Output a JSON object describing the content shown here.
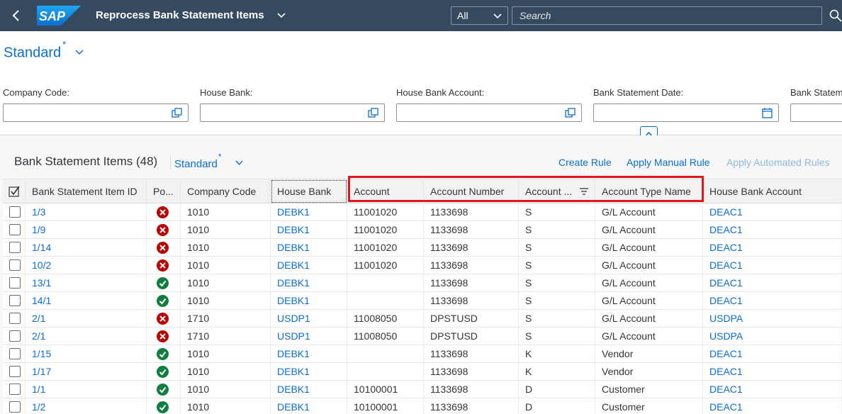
{
  "shell": {
    "app_title": "Reprocess Bank Statement Items",
    "logo_text": "SAP",
    "search_scope": "All",
    "search_placeholder": "Search"
  },
  "variant": {
    "name": "Standard",
    "modified_marker": "*"
  },
  "filters": [
    {
      "label": "Company Code:",
      "value": ""
    },
    {
      "label": "House Bank:",
      "value": ""
    },
    {
      "label": "House Bank Account:",
      "value": ""
    },
    {
      "label": "Bank Statement Date:",
      "value": ""
    },
    {
      "label": "Bank Statem",
      "value": ""
    }
  ],
  "table": {
    "title": "Bank Statement Items (48)",
    "variant_name": "Standard",
    "variant_marker": "*",
    "actions": {
      "create_rule": "Create Rule",
      "apply_manual_rule": "Apply Manual Rule",
      "apply_automated_rules": "Apply Automated Rules"
    },
    "columns": [
      "Bank Statement Item ID",
      "Po...",
      "Company Code",
      "House Bank",
      "Account",
      "Account Number",
      "Account ...",
      "Account Type Name",
      "House Bank Account"
    ],
    "rows": [
      {
        "id": "1/3",
        "status": "error",
        "company": "1010",
        "bank": "DEBK1",
        "account": "11001020",
        "number": "1133698",
        "type": "S",
        "type_name": "G/L Account",
        "hba": "DEAC1"
      },
      {
        "id": "1/9",
        "status": "error",
        "company": "1010",
        "bank": "DEBK1",
        "account": "11001020",
        "number": "1133698",
        "type": "S",
        "type_name": "G/L Account",
        "hba": "DEAC1"
      },
      {
        "id": "1/14",
        "status": "error",
        "company": "1010",
        "bank": "DEBK1",
        "account": "11001020",
        "number": "1133698",
        "type": "S",
        "type_name": "G/L Account",
        "hba": "DEAC1"
      },
      {
        "id": "10/2",
        "status": "error",
        "company": "1010",
        "bank": "DEBK1",
        "account": "11001020",
        "number": "1133698",
        "type": "S",
        "type_name": "G/L Account",
        "hba": "DEAC1"
      },
      {
        "id": "13/1",
        "status": "success",
        "company": "1010",
        "bank": "DEBK1",
        "account": "",
        "number": "1133698",
        "type": "S",
        "type_name": "G/L Account",
        "hba": "DEAC1"
      },
      {
        "id": "14/1",
        "status": "success",
        "company": "1010",
        "bank": "DEBK1",
        "account": "",
        "number": "1133698",
        "type": "S",
        "type_name": "G/L Account",
        "hba": "DEAC1"
      },
      {
        "id": "2/1",
        "status": "error",
        "company": "1710",
        "bank": "USDP1",
        "account": "11008050",
        "number": "DPSTUSD",
        "type": "S",
        "type_name": "G/L Account",
        "hba": "USDPA"
      },
      {
        "id": "2/1",
        "status": "error",
        "company": "1710",
        "bank": "USDP1",
        "account": "11008050",
        "number": "DPSTUSD",
        "type": "S",
        "type_name": "G/L Account",
        "hba": "USDPA"
      },
      {
        "id": "1/15",
        "status": "success",
        "company": "1010",
        "bank": "DEBK1",
        "account": "",
        "number": "1133698",
        "type": "K",
        "type_name": "Vendor",
        "hba": "DEAC1"
      },
      {
        "id": "1/17",
        "status": "success",
        "company": "1010",
        "bank": "DEBK1",
        "account": "",
        "number": "1133698",
        "type": "K",
        "type_name": "Vendor",
        "hba": "DEAC1"
      },
      {
        "id": "1/1",
        "status": "success",
        "company": "1010",
        "bank": "DEBK1",
        "account": "10100001",
        "number": "1133698",
        "type": "D",
        "type_name": "Customer",
        "hba": "DEAC1"
      },
      {
        "id": "1/2",
        "status": "success",
        "company": "1010",
        "bank": "DEBK1",
        "account": "10100001",
        "number": "1133698",
        "type": "D",
        "type_name": "Customer",
        "hba": "DEAC1"
      }
    ]
  },
  "colors": {
    "shell": "#354a5f",
    "link": "#0a6ed1",
    "error": "#bb0000",
    "success": "#107e3e",
    "highlight": "#e0161f"
  }
}
